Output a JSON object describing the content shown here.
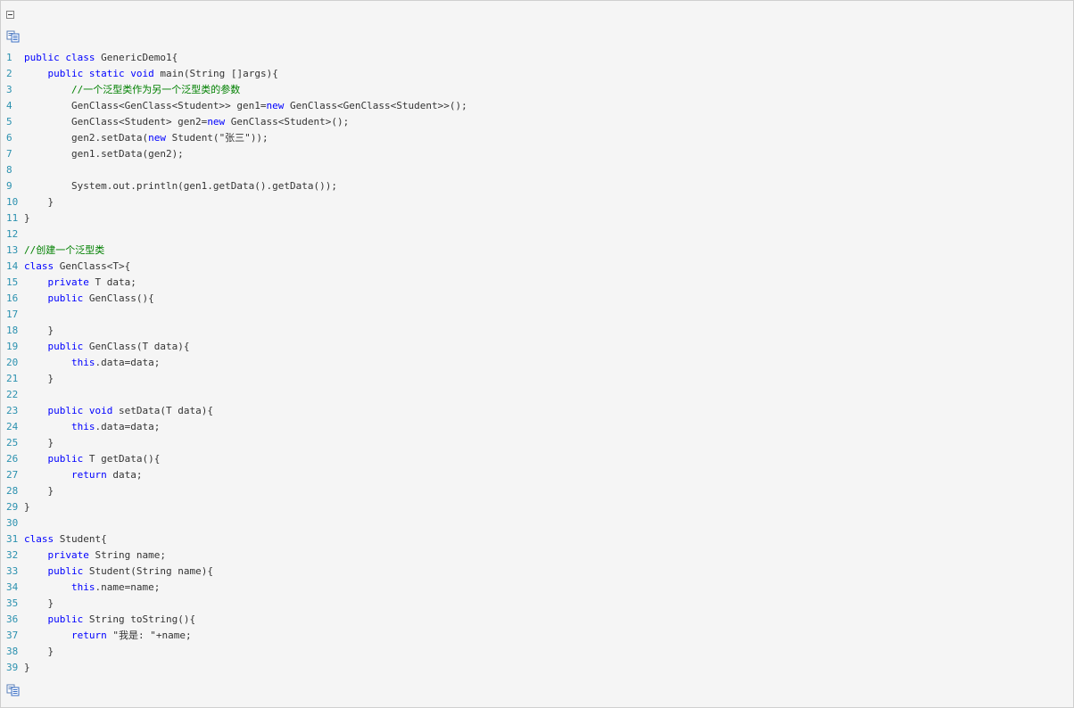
{
  "toolbar": {
    "collapse_icon": "collapse-icon",
    "copy_icon": "copy-code-icon"
  },
  "colors": {
    "background": "#f5f5f5",
    "keyword": "#0000ff",
    "comment": "#008000",
    "line_number": "#2b91af",
    "text": "#333333"
  },
  "code_lines": [
    {
      "n": "1",
      "tokens": [
        {
          "t": "kw",
          "v": "public"
        },
        {
          "t": "tx",
          "v": " "
        },
        {
          "t": "kw",
          "v": "class"
        },
        {
          "t": "tx",
          "v": " GenericDemo1{"
        }
      ]
    },
    {
      "n": "2",
      "tokens": [
        {
          "t": "tx",
          "v": "    "
        },
        {
          "t": "kw",
          "v": "public"
        },
        {
          "t": "tx",
          "v": " "
        },
        {
          "t": "kw",
          "v": "static"
        },
        {
          "t": "tx",
          "v": " "
        },
        {
          "t": "kw",
          "v": "void"
        },
        {
          "t": "tx",
          "v": " main(String []args){"
        }
      ]
    },
    {
      "n": "3",
      "tokens": [
        {
          "t": "tx",
          "v": "        "
        },
        {
          "t": "cm",
          "v": "//一个泛型类作为另一个泛型类的参数"
        }
      ]
    },
    {
      "n": "4",
      "tokens": [
        {
          "t": "tx",
          "v": "        GenClass<GenClass<Student>> gen1="
        },
        {
          "t": "kw",
          "v": "new"
        },
        {
          "t": "tx",
          "v": " GenClass<GenClass<Student>>();"
        }
      ]
    },
    {
      "n": "5",
      "tokens": [
        {
          "t": "tx",
          "v": "        GenClass<Student> gen2="
        },
        {
          "t": "kw",
          "v": "new"
        },
        {
          "t": "tx",
          "v": " GenClass<Student>();"
        }
      ]
    },
    {
      "n": "6",
      "tokens": [
        {
          "t": "tx",
          "v": "        gen2.setData("
        },
        {
          "t": "kw",
          "v": "new"
        },
        {
          "t": "tx",
          "v": " Student("
        },
        {
          "t": "st",
          "v": "\"张三\""
        },
        {
          "t": "tx",
          "v": "));"
        }
      ]
    },
    {
      "n": "7",
      "tokens": [
        {
          "t": "tx",
          "v": "        gen1.setData(gen2);"
        }
      ]
    },
    {
      "n": "8",
      "tokens": [
        {
          "t": "tx",
          "v": ""
        }
      ]
    },
    {
      "n": "9",
      "tokens": [
        {
          "t": "tx",
          "v": "        System.out.println(gen1.getData().getData());"
        }
      ]
    },
    {
      "n": "10",
      "tokens": [
        {
          "t": "tx",
          "v": "    }"
        }
      ]
    },
    {
      "n": "11",
      "tokens": [
        {
          "t": "tx",
          "v": "}"
        }
      ]
    },
    {
      "n": "12",
      "tokens": [
        {
          "t": "tx",
          "v": ""
        }
      ]
    },
    {
      "n": "13",
      "tokens": [
        {
          "t": "cm",
          "v": "//创建一个泛型类"
        }
      ]
    },
    {
      "n": "14",
      "tokens": [
        {
          "t": "kw",
          "v": "class"
        },
        {
          "t": "tx",
          "v": " GenClass<T>{"
        }
      ]
    },
    {
      "n": "15",
      "tokens": [
        {
          "t": "tx",
          "v": "    "
        },
        {
          "t": "kw",
          "v": "private"
        },
        {
          "t": "tx",
          "v": " T data;"
        }
      ]
    },
    {
      "n": "16",
      "tokens": [
        {
          "t": "tx",
          "v": "    "
        },
        {
          "t": "kw",
          "v": "public"
        },
        {
          "t": "tx",
          "v": " GenClass(){"
        }
      ]
    },
    {
      "n": "17",
      "tokens": [
        {
          "t": "tx",
          "v": ""
        }
      ]
    },
    {
      "n": "18",
      "tokens": [
        {
          "t": "tx",
          "v": "    }"
        }
      ]
    },
    {
      "n": "19",
      "tokens": [
        {
          "t": "tx",
          "v": "    "
        },
        {
          "t": "kw",
          "v": "public"
        },
        {
          "t": "tx",
          "v": " GenClass(T data){"
        }
      ]
    },
    {
      "n": "20",
      "tokens": [
        {
          "t": "tx",
          "v": "        "
        },
        {
          "t": "kw",
          "v": "this"
        },
        {
          "t": "tx",
          "v": ".data=data;"
        }
      ]
    },
    {
      "n": "21",
      "tokens": [
        {
          "t": "tx",
          "v": "    }"
        }
      ]
    },
    {
      "n": "22",
      "tokens": [
        {
          "t": "tx",
          "v": ""
        }
      ]
    },
    {
      "n": "23",
      "tokens": [
        {
          "t": "tx",
          "v": "    "
        },
        {
          "t": "kw",
          "v": "public"
        },
        {
          "t": "tx",
          "v": " "
        },
        {
          "t": "kw",
          "v": "void"
        },
        {
          "t": "tx",
          "v": " setData(T data){"
        }
      ]
    },
    {
      "n": "24",
      "tokens": [
        {
          "t": "tx",
          "v": "        "
        },
        {
          "t": "kw",
          "v": "this"
        },
        {
          "t": "tx",
          "v": ".data=data;"
        }
      ]
    },
    {
      "n": "25",
      "tokens": [
        {
          "t": "tx",
          "v": "    }"
        }
      ]
    },
    {
      "n": "26",
      "tokens": [
        {
          "t": "tx",
          "v": "    "
        },
        {
          "t": "kw",
          "v": "public"
        },
        {
          "t": "tx",
          "v": " T getData(){"
        }
      ]
    },
    {
      "n": "27",
      "tokens": [
        {
          "t": "tx",
          "v": "        "
        },
        {
          "t": "kw",
          "v": "return"
        },
        {
          "t": "tx",
          "v": " data;"
        }
      ]
    },
    {
      "n": "28",
      "tokens": [
        {
          "t": "tx",
          "v": "    }"
        }
      ]
    },
    {
      "n": "29",
      "tokens": [
        {
          "t": "tx",
          "v": "}"
        }
      ]
    },
    {
      "n": "30",
      "tokens": [
        {
          "t": "tx",
          "v": ""
        }
      ]
    },
    {
      "n": "31",
      "tokens": [
        {
          "t": "kw",
          "v": "class"
        },
        {
          "t": "tx",
          "v": " Student{"
        }
      ]
    },
    {
      "n": "32",
      "tokens": [
        {
          "t": "tx",
          "v": "    "
        },
        {
          "t": "kw",
          "v": "private"
        },
        {
          "t": "tx",
          "v": " String name;"
        }
      ]
    },
    {
      "n": "33",
      "tokens": [
        {
          "t": "tx",
          "v": "    "
        },
        {
          "t": "kw",
          "v": "public"
        },
        {
          "t": "tx",
          "v": " Student(String name){"
        }
      ]
    },
    {
      "n": "34",
      "tokens": [
        {
          "t": "tx",
          "v": "        "
        },
        {
          "t": "kw",
          "v": "this"
        },
        {
          "t": "tx",
          "v": ".name=name;"
        }
      ]
    },
    {
      "n": "35",
      "tokens": [
        {
          "t": "tx",
          "v": "    }"
        }
      ]
    },
    {
      "n": "36",
      "tokens": [
        {
          "t": "tx",
          "v": "    "
        },
        {
          "t": "kw",
          "v": "public"
        },
        {
          "t": "tx",
          "v": " String toString(){"
        }
      ]
    },
    {
      "n": "37",
      "tokens": [
        {
          "t": "tx",
          "v": "        "
        },
        {
          "t": "kw",
          "v": "return"
        },
        {
          "t": "tx",
          "v": " "
        },
        {
          "t": "st",
          "v": "\"我是: \""
        },
        {
          "t": "tx",
          "v": "+name;"
        }
      ]
    },
    {
      "n": "38",
      "tokens": [
        {
          "t": "tx",
          "v": "    }"
        }
      ]
    },
    {
      "n": "39",
      "tokens": [
        {
          "t": "tx",
          "v": "}"
        }
      ]
    }
  ]
}
